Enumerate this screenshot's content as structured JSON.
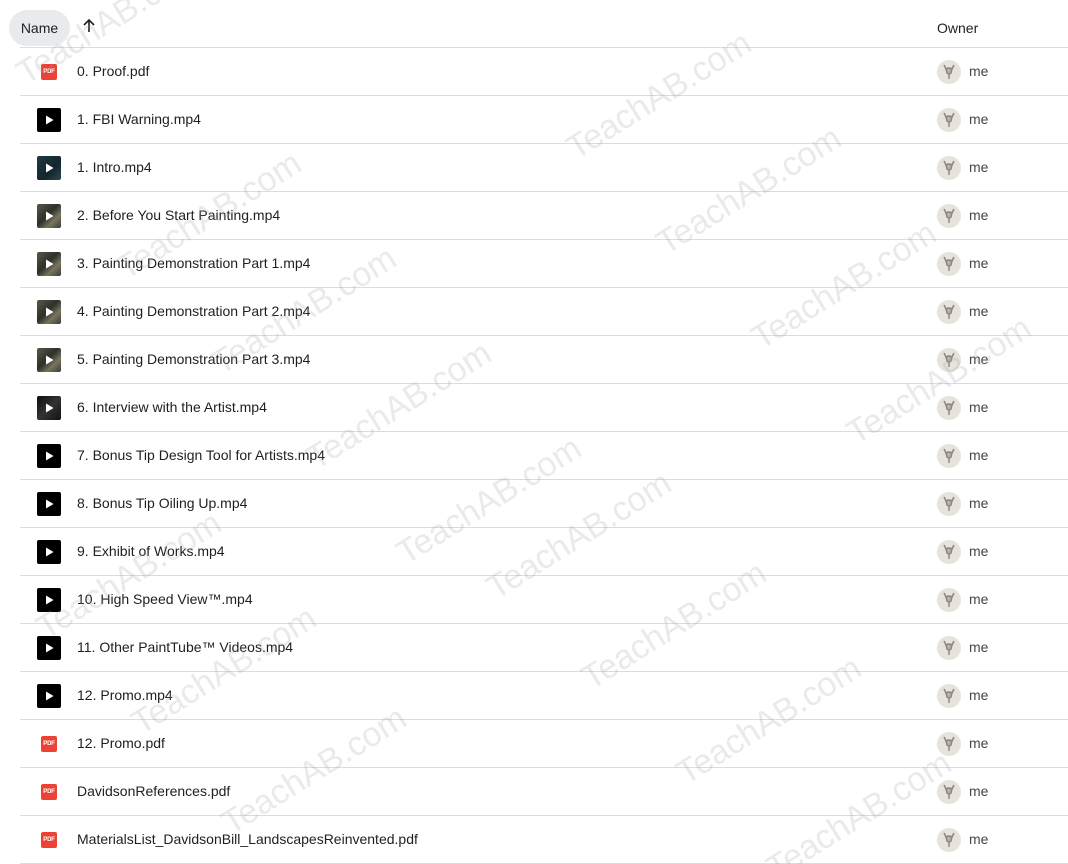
{
  "header": {
    "name_label": "Name",
    "sort_icon": "arrow-up-icon",
    "owner_label": "Owner"
  },
  "files": [
    {
      "name": "0. Proof.pdf",
      "type": "pdf",
      "owner": "me"
    },
    {
      "name": "1. FBI Warning.mp4",
      "type": "video",
      "owner": "me"
    },
    {
      "name": "1. Intro.mp4",
      "type": "video-thumb",
      "owner": "me"
    },
    {
      "name": "2. Before You Start Painting.mp4",
      "type": "video-thumb",
      "owner": "me"
    },
    {
      "name": "3. Painting Demonstration Part 1.mp4",
      "type": "video-thumb",
      "owner": "me"
    },
    {
      "name": "4. Painting Demonstration Part 2.mp4",
      "type": "video-thumb",
      "owner": "me"
    },
    {
      "name": "5. Painting Demonstration Part 3.mp4",
      "type": "video-thumb",
      "owner": "me"
    },
    {
      "name": "6. Interview with the Artist.mp4",
      "type": "video-thumb",
      "owner": "me"
    },
    {
      "name": "7. Bonus Tip Design Tool for Artists.mp4",
      "type": "video",
      "owner": "me"
    },
    {
      "name": "8. Bonus Tip Oiling Up.mp4",
      "type": "video",
      "owner": "me"
    },
    {
      "name": "9. Exhibit of Works.mp4",
      "type": "video",
      "owner": "me"
    },
    {
      "name": "10. High Speed View™.mp4",
      "type": "video",
      "owner": "me"
    },
    {
      "name": "11. Other PaintTube™ Videos.mp4",
      "type": "video",
      "owner": "me"
    },
    {
      "name": "12. Promo.mp4",
      "type": "video",
      "owner": "me"
    },
    {
      "name": "12. Promo.pdf",
      "type": "pdf",
      "owner": "me"
    },
    {
      "name": "DavidsonReferences.pdf",
      "type": "pdf",
      "owner": "me"
    },
    {
      "name": "MaterialsList_DavidsonBill_LandscapesReinvented.pdf",
      "type": "pdf",
      "owner": "me"
    }
  ],
  "pdf_badge_text": "PDF",
  "watermark_text": "TeachAB.com",
  "colors": {
    "pdf_red": "#ea4335",
    "divider": "#dadce0",
    "chip_bg": "#e9eaec"
  }
}
